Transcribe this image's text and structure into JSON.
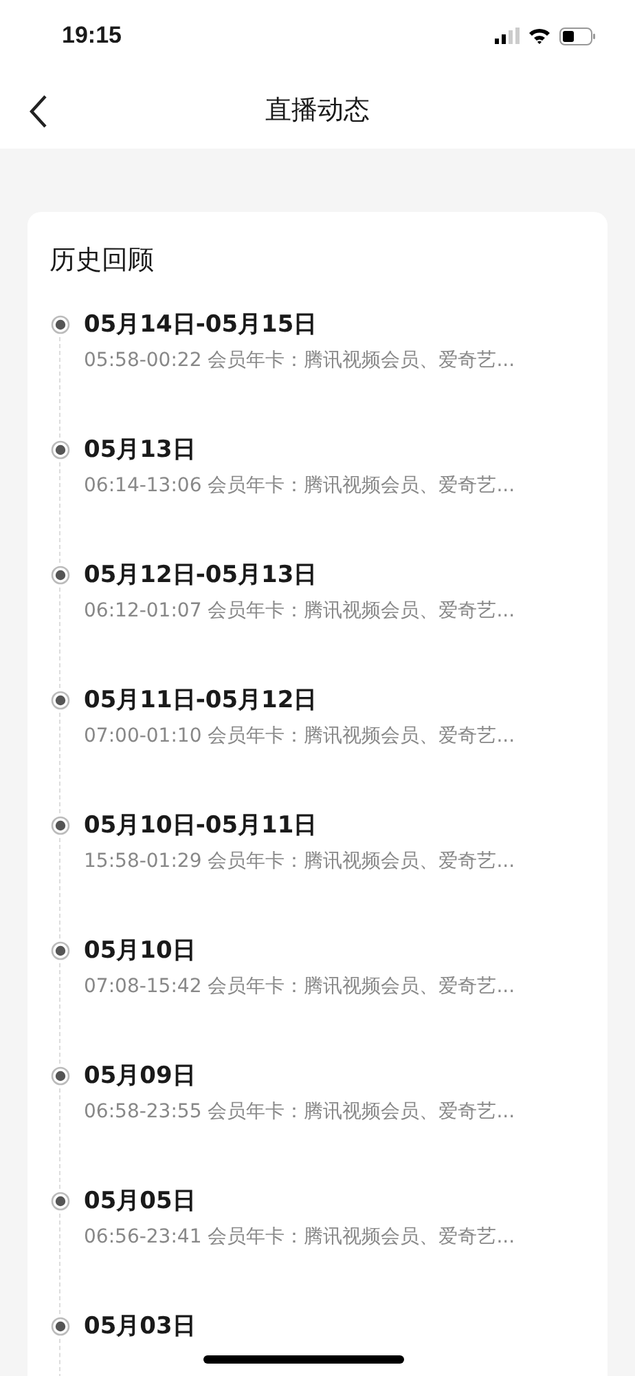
{
  "status_bar": {
    "time": "19:15"
  },
  "nav": {
    "title": "直播动态"
  },
  "section": {
    "title": "历史回顾",
    "items": [
      {
        "date": "05月14日-05月15日",
        "detail": "05:58-00:22 会员年卡：腾讯视频会员、爱奇艺..."
      },
      {
        "date": "05月13日",
        "detail": "06:14-13:06 会员年卡：腾讯视频会员、爱奇艺..."
      },
      {
        "date": "05月12日-05月13日",
        "detail": "06:12-01:07 会员年卡：腾讯视频会员、爱奇艺..."
      },
      {
        "date": "05月11日-05月12日",
        "detail": "07:00-01:10 会员年卡：腾讯视频会员、爱奇艺..."
      },
      {
        "date": "05月10日-05月11日",
        "detail": "15:58-01:29 会员年卡：腾讯视频会员、爱奇艺..."
      },
      {
        "date": "05月10日",
        "detail": "07:08-15:42 会员年卡：腾讯视频会员、爱奇艺..."
      },
      {
        "date": "05月09日",
        "detail": "06:58-23:55 会员年卡：腾讯视频会员、爱奇艺..."
      },
      {
        "date": "05月05日",
        "detail": "06:56-23:41 会员年卡：腾讯视频会员、爱奇艺..."
      },
      {
        "date": "05月03日"
      }
    ]
  }
}
